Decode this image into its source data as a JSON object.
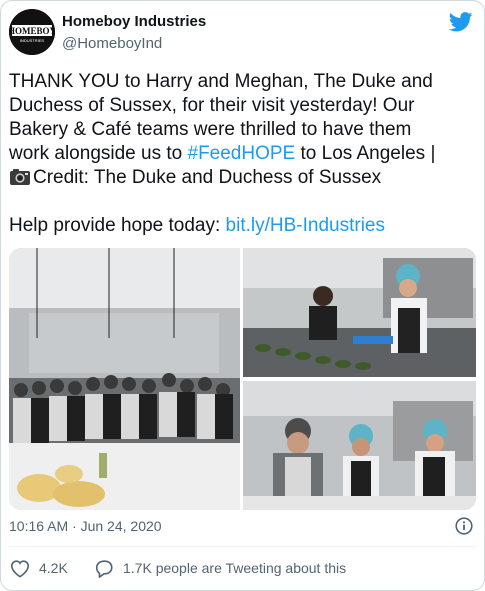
{
  "account": {
    "name": "Homeboy Industries",
    "handle": "@HomeboyInd",
    "avatar_text": "HOMEBOY",
    "avatar_subtext": "INDUSTRIES"
  },
  "tweet": {
    "line1": "THANK YOU to Harry and Meghan, The Duke and",
    "line2": "Duchess of Sussex, for their visit yesterday! Our",
    "line3": "Bakery & Café teams were thrilled to have them",
    "line4_pre": "work alongside us to ",
    "hashtag": "#FeedHOPE",
    "line4_post": " to Los Angeles |",
    "credit": "Credit: The Duke and Duchess of Sussex",
    "help_pre": "Help provide hope today: ",
    "help_link": "bit.ly/HB-Industries"
  },
  "meta": {
    "timestamp": "10:16 AM · Jun 24, 2020"
  },
  "actions": {
    "likes": "4.2K",
    "replies": "1.7K people are Tweeting about this"
  },
  "icons": {
    "brand": "twitter-bird-icon",
    "camera": "camera-emoji-icon",
    "info": "info-icon",
    "like": "heart-icon",
    "reply": "comment-icon"
  },
  "colors": {
    "link": "#1d9bf0",
    "text": "#0f1419",
    "muted": "#536471"
  }
}
